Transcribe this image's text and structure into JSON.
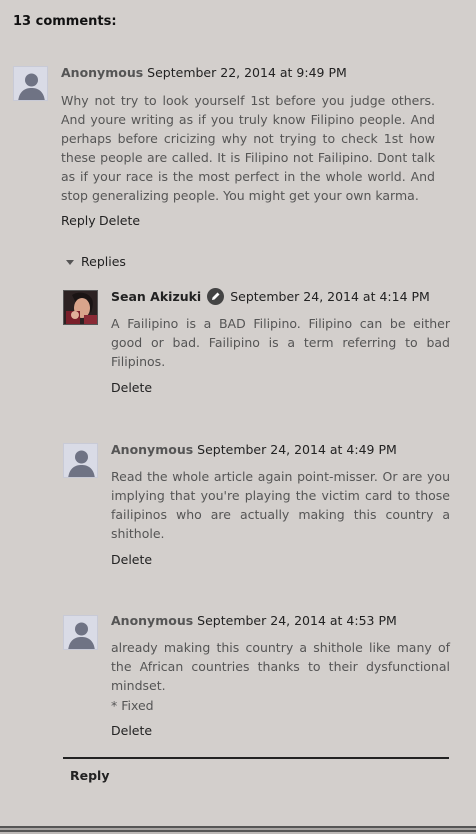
{
  "comments_heading": "13 comments:",
  "comments": [
    {
      "author": "Anonymous",
      "date": "September 22, 2014 at 9:49 PM",
      "body": "Why not try to look yourself 1st before you judge others. And youre writing as if you truly know Filipino people. And perhaps before cricizing why not trying to check 1st how these people are called. It is Filipino not Failipino. Dont talk as if your race is the most perfect in the whole world. And stop generalizing people. You might get your own karma.",
      "reply_label": "Reply",
      "delete_label": "Delete"
    }
  ],
  "replies_label": "Replies",
  "replies": [
    {
      "author": "Sean Akizuki",
      "date": "September 24, 2014 at 4:14 PM",
      "body": "A Failipino is a BAD Filipino. Filipino can be either good or bad. Failipino is a term referring to bad Filipinos.",
      "delete_label": "Delete"
    },
    {
      "author": "Anonymous",
      "date": "September 24, 2014 at 4:49 PM",
      "body": "Read the whole article again point-misser. Or are you implying that you're playing the victim card to those failipinos who are actually making this country a shithole.",
      "delete_label": "Delete"
    },
    {
      "author": "Anonymous",
      "date": "September 24, 2014 at 4:53 PM",
      "body": "already making this country a shithole like many of the African countries thanks to their dysfunctional mindset.",
      "body2": "* Fixed",
      "delete_label": "Delete"
    }
  ],
  "reply_button_label": "Reply",
  "icons": {
    "default_avatar": "person-silhouette-icon",
    "author_badge": "pencil-icon",
    "toggle": "triangle-down-icon"
  }
}
